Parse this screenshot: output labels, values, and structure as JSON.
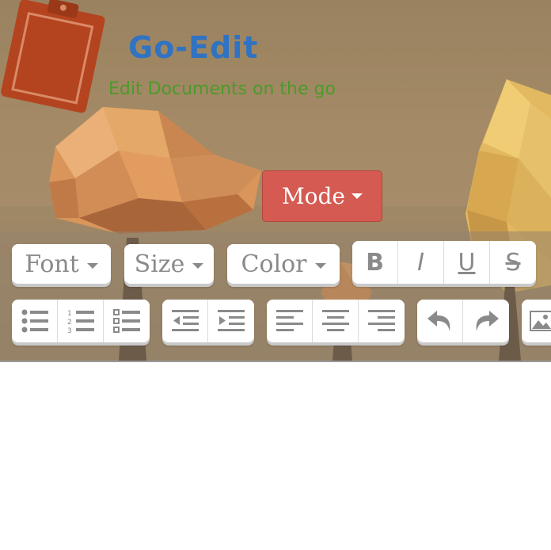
{
  "brand": {
    "title": "Go-Edit",
    "tagline": "Edit Documents on the go",
    "title_color": "#2f73c2",
    "tagline_color": "#4c9a2a",
    "logo_icon": "clipboard-icon"
  },
  "mode": {
    "label": "Mode",
    "color": "#d45a52"
  },
  "toolbar": {
    "font_label": "Font",
    "size_label": "Size",
    "color_label": "Color",
    "bold_label": "B",
    "italic_label": "I",
    "underline_label": "U",
    "strike_label": "S",
    "icons": [
      "unordered-list-icon",
      "ordered-list-icon",
      "checklist-icon",
      "outdent-icon",
      "indent-icon",
      "align-left-icon",
      "align-center-icon",
      "align-right-icon",
      "undo-icon",
      "redo-icon",
      "image-icon"
    ]
  },
  "editor": {
    "content": ""
  }
}
